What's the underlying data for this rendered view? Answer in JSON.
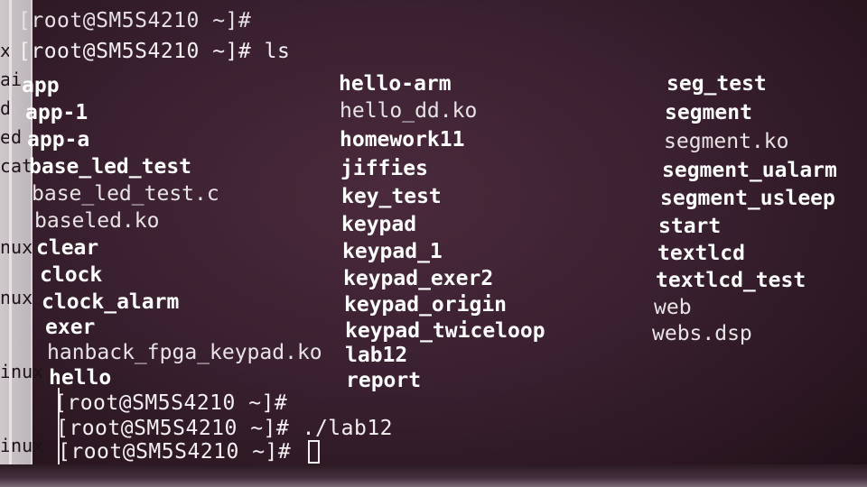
{
  "side_window": {
    "fragments": [
      "x",
      "ai",
      "d",
      "ed",
      "cat",
      "nux",
      "nux",
      "inux",
      "inux"
    ]
  },
  "terminal": {
    "top_lines": [
      "[root@SM5S4210 ~]#",
      "[root@SM5S4210 ~]# ls"
    ],
    "listing": {
      "col1": [
        "app",
        "app-1",
        "app-a",
        "base_led_test",
        "base_led_test.c",
        "baseled.ko",
        "clear",
        "clock",
        "clock_alarm",
        "exer",
        "hanback_fpga_keypad.ko",
        "hello"
      ],
      "col2": [
        "hello-arm",
        "hello_dd.ko",
        "homework11",
        "jiffies",
        "key_test",
        "keypad",
        "keypad_1",
        "keypad_exer2",
        "keypad_origin",
        "keypad_twiceloop",
        "lab12",
        "report"
      ],
      "col3": [
        "seg_test",
        "segment",
        "segment.ko",
        "segment_ualarm",
        "segment_usleep",
        "start",
        "textlcd",
        "textlcd_test",
        "web",
        "webs.dsp"
      ]
    },
    "bottom_lines": [
      "[root@SM5S4210 ~]#",
      "[root@SM5S4210 ~]# ./lab12",
      "[root@SM5S4210 ~]#"
    ]
  }
}
